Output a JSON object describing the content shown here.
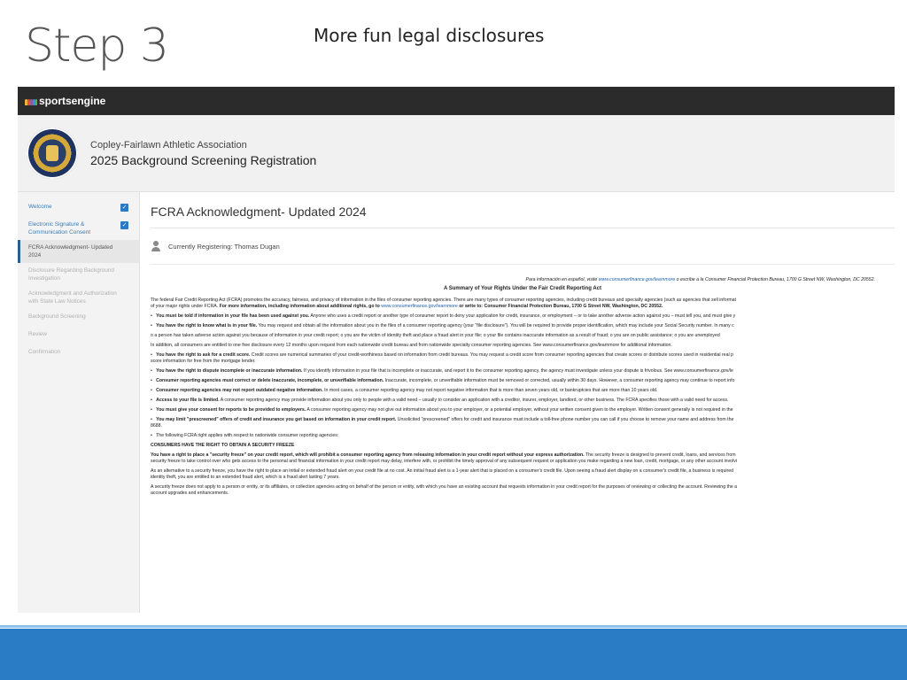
{
  "slide": {
    "title": "Step 3",
    "subtitle": "More fun legal disclosures"
  },
  "app": {
    "brand": "sportsengine",
    "org_name": "Copley-Fairlawn Athletic Association",
    "registration_title": "2025 Background Screening Registration"
  },
  "sidebar": {
    "items": [
      {
        "label": "Welcome",
        "state": "done"
      },
      {
        "label": "Electronic Signature & Communication Consent",
        "state": "done"
      },
      {
        "label": "FCRA Acknowledgment- Updated 2024",
        "state": "active"
      },
      {
        "label": "Disclosure Regarding Background Investigation",
        "state": "disabled"
      },
      {
        "label": "Acknowledgment and Authorization with State Law Notices",
        "state": "disabled"
      },
      {
        "label": "Background Screening",
        "state": "disabled"
      },
      {
        "label": "Review",
        "state": "disabled"
      },
      {
        "label": "Confirmation",
        "state": "disabled"
      }
    ],
    "check_glyph": "✓"
  },
  "main": {
    "title": "FCRA Acknowledgment- Updated 2024",
    "registering_label": "Currently Registering: Thomas Dugan",
    "doc": {
      "spanish_prefix": "Para información en español, visite ",
      "spanish_link": "www.consumerfinance.gov/learnmore",
      "spanish_suffix": " o escribe a la Consumer Financial Protection Bureau, 1700 G Street NW, Washington, DC 20552.",
      "summary_title": "A Summary of Your Rights Under the Fair Credit Reporting Act",
      "intro_1": "The federal Fair Credit Reporting Act (FCRA) promotes the accuracy, fairness, and privacy of information in the files of consumer reporting agencies.  There are many types of consumer reporting agencies, including credit bureaus and specialty agencies (such as agencies that sell informat",
      "intro_2_a": "of your major rights under FCRA. ",
      "intro_2_b": "For more information, including information about additional rights, go to ",
      "intro_2_link": "www.consumerfinance.gov/learnmore",
      "intro_2_c": " or write to: Consumer Financial Protection Bureau, 1700 G Street NW, Washington, DC 20552.",
      "p1_b": "You must be told if information in your file has been used against you.",
      "p1": "  Anyone who uses a credit report or another type of consumer report to deny your application for credit, insurance, or employment – or to take another adverse action against you – must tell you, and must give y",
      "p2_b": "You have the right to know what is in your file.",
      "p2": "  You may request and obtain all the information about you in the files of a consumer reporting agency (your \"file disclosure\").  You will be required to provide proper identification, which may include your Social Security number.  In many c",
      "p3": "o    a person has taken adverse action against you because of information in your credit report;  o     you are the victim of identity theft and place a fraud alert in your file;  o     your file contains inaccurate information as a result of fraud;  o     you are on public assistance;  o     you are unemployed",
      "p4": "In addition, all consumers are entitled to one free disclosure every 12 months upon request from each nationwide credit bureau and from nationwide specialty consumer reporting agencies.  See www.consumerfinance.gov/learnmore for additional information.",
      "p5_b": "You have the right to ask for a credit score.",
      "p5": "  Credit scores are numerical summaries of your credit-worthiness based on information from credit bureaus.  You may request a credit score from consumer reporting agencies that create scores or distribute scores used in residential real p",
      "p5_2": "score information for free from the mortgage lender.",
      "p6_b": "You have the right to dispute incomplete or inaccurate information.",
      "p6": "  If you identify information in your file that is incomplete or inaccurate, and report it to the consumer reporting agency, the agency must investigate unless your dispute is frivolous.  See www.consumerfinance.gov/le",
      "p7_b": "Consumer reporting agencies must correct or delete inaccurate, incomplete, or unverifiable information.",
      "p7": "  Inaccurate, incomplete, or unverifiable information must be removed or corrected, usually within 30 days.  However, a consumer reporting agency may continue to report info",
      "p8_b": "Consumer reporting agencies may not report outdated negative information.",
      "p8": "  In most cases, a consumer reporting agency may not report negative information that is more than seven years old, or bankruptcies that are more than 10 years old.",
      "p9_b": "Access to your file is limited.",
      "p9": "  A consumer reporting agency may provide information about you only to people with a valid need – usually to consider an application with a creditor, insurer, employer, landlord, or other business.  The FCRA specifies those with a valid need for access.",
      "p10_b": "You must give your consent for reports to be provided to employers.",
      "p10": "  A consumer reporting agency may not give out information about you to your employer, or a potential employer, without your written consent given to the employer.  Written consent generally is not required in the",
      "p11_b": "You may limit \"prescreened\" offers of credit and insurance you get based on information in your credit report.",
      "p11": "  Unsolicited \"prescreened\" offers for credit and insurance must include a toll-free phone number you can call if you choose to remove your name and address from the",
      "p11_2": "8688.",
      "p12": "The following FCRA right applies with respect to nationwide consumer reporting agencies:",
      "p13_b": "CONSUMERS HAVE THE RIGHT TO OBTAIN A SECURITY FREEZE",
      "p14_b": "You have a right to place a \"security freeze\" on your credit report, which will prohibit a consumer reporting agency from releasing information in your credit report without your express authorization.",
      "p14": "  The security freeze is designed to prevent credit, loans, and services from",
      "p14_2": "security freeze to take control over who gets access to the personal and financial information in your credit report may delay, interfere with, or prohibit the timely approval of any subsequent request or application you make regarding a new loan, credit, mortgage, or any other account involvi",
      "p15": "As an alternative to a security freeze, you have the right to place an initial or extended fraud alert on your credit file at no cost.  An initial fraud alert is a 1-year alert that is placed on a consumer's credit file.  Upon seeing a fraud alert display on a consumer's credit file, a business is required",
      "p15_2": "identity theft, you are entitled to an extended fraud alert, which is a fraud alert lasting 7 years.",
      "p16": "A security freeze does not apply to a person or entity, or its affiliates, or collection agencies acting on behalf of the person or entity, with which you have an existing account that requests information in your credit report for the purposes of reviewing or collecting the account.  Reviewing the a",
      "p16_2": "account upgrades and enhancements."
    }
  },
  "colors": {
    "topbar": "#2b2b2b",
    "accent": "#2979c7",
    "footer_band": "#2a7cc4"
  }
}
